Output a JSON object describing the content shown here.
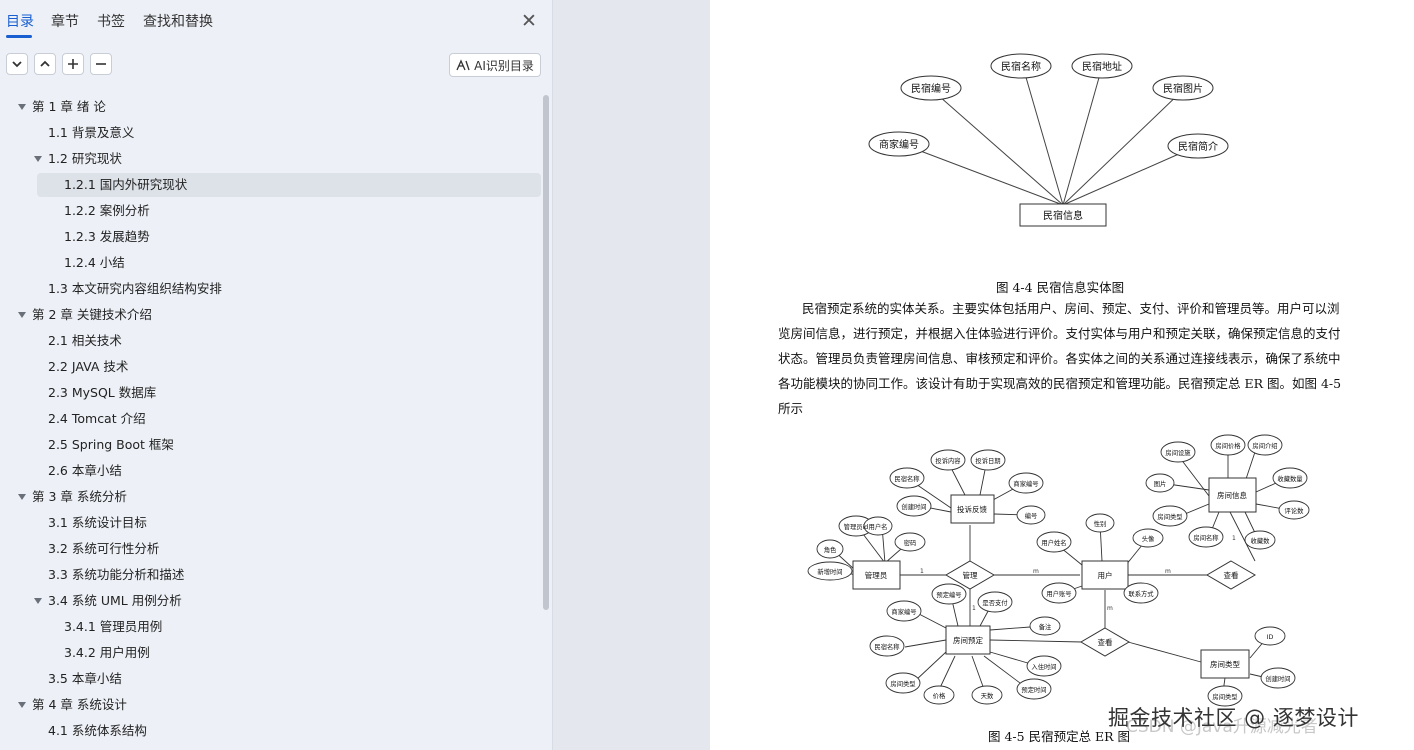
{
  "sidebar": {
    "tabs": [
      {
        "label": "目录",
        "active": true
      },
      {
        "label": "章节"
      },
      {
        "label": "书签"
      },
      {
        "label": "查找和替换"
      }
    ],
    "ai_button_label": "AI识别目录",
    "toc": [
      {
        "label": "第 1 章  绪  论",
        "level": 0,
        "expanded": true
      },
      {
        "label": "1.1 背景及意义",
        "level": 1
      },
      {
        "label": "1.2  研究现状",
        "level": 1,
        "expanded": true
      },
      {
        "label": "1.2.1  国内外研究现状",
        "level": 2,
        "selected": true
      },
      {
        "label": "1.2.2  案例分析",
        "level": 2
      },
      {
        "label": "1.2.3  发展趋势",
        "level": 2
      },
      {
        "label": "1.2.4  小结",
        "level": 2
      },
      {
        "label": "1.3  本文研究内容组织结构安排",
        "level": 1
      },
      {
        "label": "第 2 章  关键技术介绍",
        "level": 0,
        "expanded": true
      },
      {
        "label": "2.1 相关技术",
        "level": 1
      },
      {
        "label": "2.2 JAVA 技术",
        "level": 1
      },
      {
        "label": "2.3 MySQL 数据库",
        "level": 1
      },
      {
        "label": "2.4 Tomcat 介绍",
        "level": 1
      },
      {
        "label": "2.5 Spring Boot 框架",
        "level": 1
      },
      {
        "label": "2.6  本章小结",
        "level": 1
      },
      {
        "label": "第 3 章  系统分析",
        "level": 0,
        "expanded": true
      },
      {
        "label": "3.1  系统设计目标",
        "level": 1
      },
      {
        "label": "3.2  系统可行性分析",
        "level": 1
      },
      {
        "label": "3.3  系统功能分析和描述",
        "level": 1
      },
      {
        "label": "3.4 系统 UML 用例分析",
        "level": 1,
        "expanded": true
      },
      {
        "label": "3.4.1 管理员用例",
        "level": 2
      },
      {
        "label": "3.4.2 用户用例",
        "level": 2
      },
      {
        "label": "3.5  本章小结",
        "level": 1
      },
      {
        "label": "第 4 章  系统设计",
        "level": 0,
        "expanded": true
      },
      {
        "label": "4.1  系统体系结构",
        "level": 1
      }
    ]
  },
  "document": {
    "figure1": {
      "center": "民宿信息",
      "attributes": [
        "商家编号",
        "民宿编号",
        "民宿名称",
        "民宿地址",
        "民宿图片",
        "民宿简介"
      ],
      "caption": "图 4-4 民宿信息实体图"
    },
    "paragraph": [
      "民宿预定系统的实体关系。主要实体包括用户、房间、预定、支付、评价和管理员等。用户可以浏",
      "览房间信息，进行预定，并根据入住体验进行评价。支付实体与用户和预定关联，确保预定信息的支付",
      "状态。管理员负责管理房间信息、审核预定和评价。各实体之间的关系通过连接线表示，确保了系统中",
      "各功能模块的协同工作。该设计有助于实现高效的民宿预定和管理功能。民宿预定总 ER 图。如图 4-5",
      "所示"
    ],
    "figure2": {
      "caption": "图 4-5  民宿预定总 ER 图",
      "entities": {
        "admin": "管理员",
        "feedback": "投诉反馈",
        "user": "用户",
        "room_info": "房间信息",
        "booking": "房间预定",
        "room_type": "房间类型"
      },
      "relations": {
        "manage": "管理",
        "view1": "查看",
        "view2": "查看"
      },
      "rel_cardinality": {
        "one": "1",
        "many": "m"
      },
      "attributes": {
        "admin": [
          "管理员id",
          "用户名",
          "角色",
          "密码",
          "新增时间"
        ],
        "feedback": [
          "民宿名称",
          "投诉内容",
          "投诉日期",
          "商家编号",
          "创建时间",
          "编号"
        ],
        "user": [
          "性别",
          "用户姓名",
          "头像",
          "用户账号",
          "联系方式"
        ],
        "room_info": [
          "房间设施",
          "房间价格",
          "房间介绍",
          "图片",
          "收藏数量",
          "房间类型",
          "评论数",
          "房间名称",
          "收藏数"
        ],
        "booking": [
          "商家编号",
          "预定编号",
          "是否支付",
          "民宿名称",
          "备注",
          "房间类型",
          "入住时间",
          "价格",
          "天数",
          "预定时间"
        ],
        "room_type": [
          "ID",
          "创建时间",
          "房间类型"
        ]
      }
    },
    "watermark": "掘金技术社区 @ 逐梦设计",
    "watermark_bg": "CSDN @Java升源减光者"
  }
}
